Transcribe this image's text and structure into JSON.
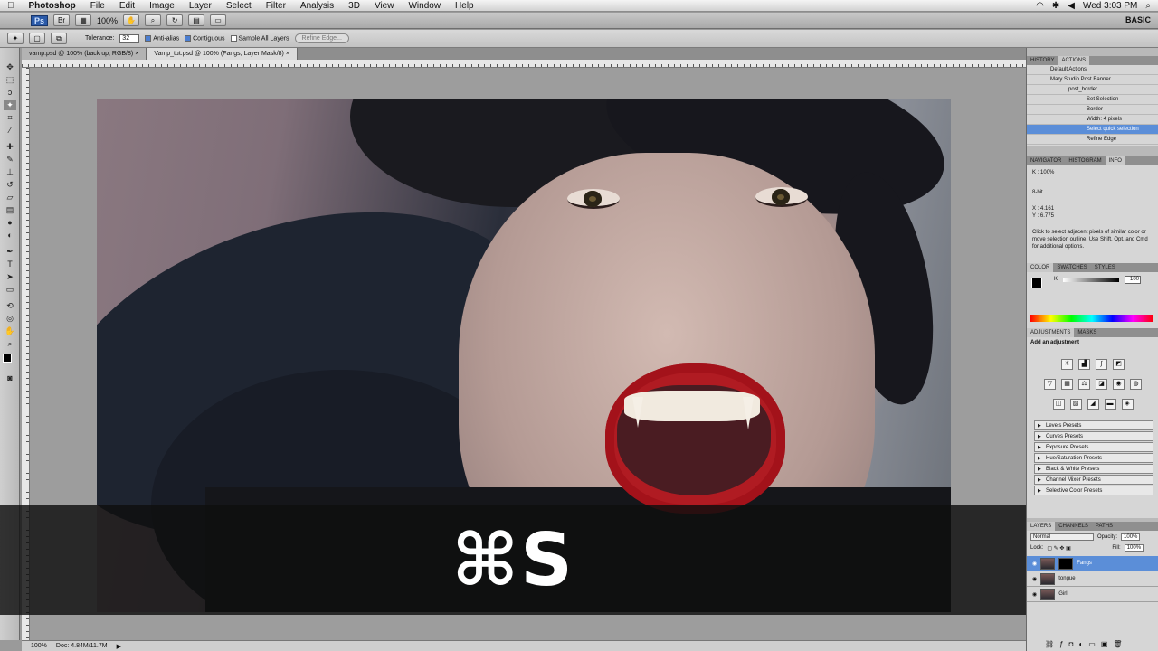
{
  "menubar": {
    "apple": "",
    "app": "Photoshop",
    "items": [
      "File",
      "Edit",
      "Image",
      "Layer",
      "Select",
      "Filter",
      "Analysis",
      "3D",
      "View",
      "Window",
      "Help"
    ],
    "clock": "Wed 3:03 PM"
  },
  "appbar": {
    "badge": "Ps",
    "zoom": "100%",
    "workspace": "BASIC"
  },
  "options": {
    "tolerance_label": "Tolerance:",
    "tolerance_value": "32",
    "anti_alias": "Anti-alias",
    "contiguous": "Contiguous",
    "sample_all": "Sample All Layers",
    "refine": "Refine Edge..."
  },
  "tabs": [
    {
      "label": "vamp.psd @ 100% (back up, RGB/8)"
    },
    {
      "label": "Vamp_tut.psd @ 100% (Fangs, Layer Mask/8)"
    }
  ],
  "overlay": {
    "shortcut": "⌘S"
  },
  "status": {
    "zoom": "100%",
    "doc": "Doc: 4.84M/11.7M"
  },
  "panels": {
    "history_tabs": [
      "HISTORY",
      "ACTIONS"
    ],
    "actions": [
      "Default Actions",
      "Mary Studio Post Banner",
      "post_border",
      "Set Selection",
      "Border",
      "Width: 4 pixels",
      "Select quick selection",
      "Refine Edge"
    ],
    "info_tabs": [
      "NAVIGATOR",
      "HISTOGRAM",
      "INFO"
    ],
    "info_k": "K :",
    "info_kv": "100%",
    "info_bit": "8-bit",
    "info_x": "X :",
    "info_y": "Y :",
    "info_xv": "4.161",
    "info_yv": "6.775",
    "info_hint": "Click to select adjacent pixels of similar color or move selection outline. Use Shift, Opt, and Cmd for additional options.",
    "color_tabs": [
      "COLOR",
      "SWATCHES",
      "STYLES"
    ],
    "color_k": "K",
    "color_kv": "100",
    "adj_tabs": [
      "ADJUSTMENTS",
      "MASKS"
    ],
    "adj_title": "Add an adjustment",
    "presets": [
      "Levels Presets",
      "Curves Presets",
      "Exposure Presets",
      "Hue/Saturation Presets",
      "Black & White Presets",
      "Channel Mixer Presets",
      "Selective Color Presets"
    ],
    "layer_tabs": [
      "LAYERS",
      "CHANNELS",
      "PATHS"
    ],
    "blend": "Normal",
    "opacity_label": "Opacity:",
    "opacity": "100%",
    "lock_label": "Lock:",
    "fill_label": "Fill:",
    "fill": "100%",
    "layers": [
      "Fangs",
      "tongue",
      "Girl"
    ]
  }
}
